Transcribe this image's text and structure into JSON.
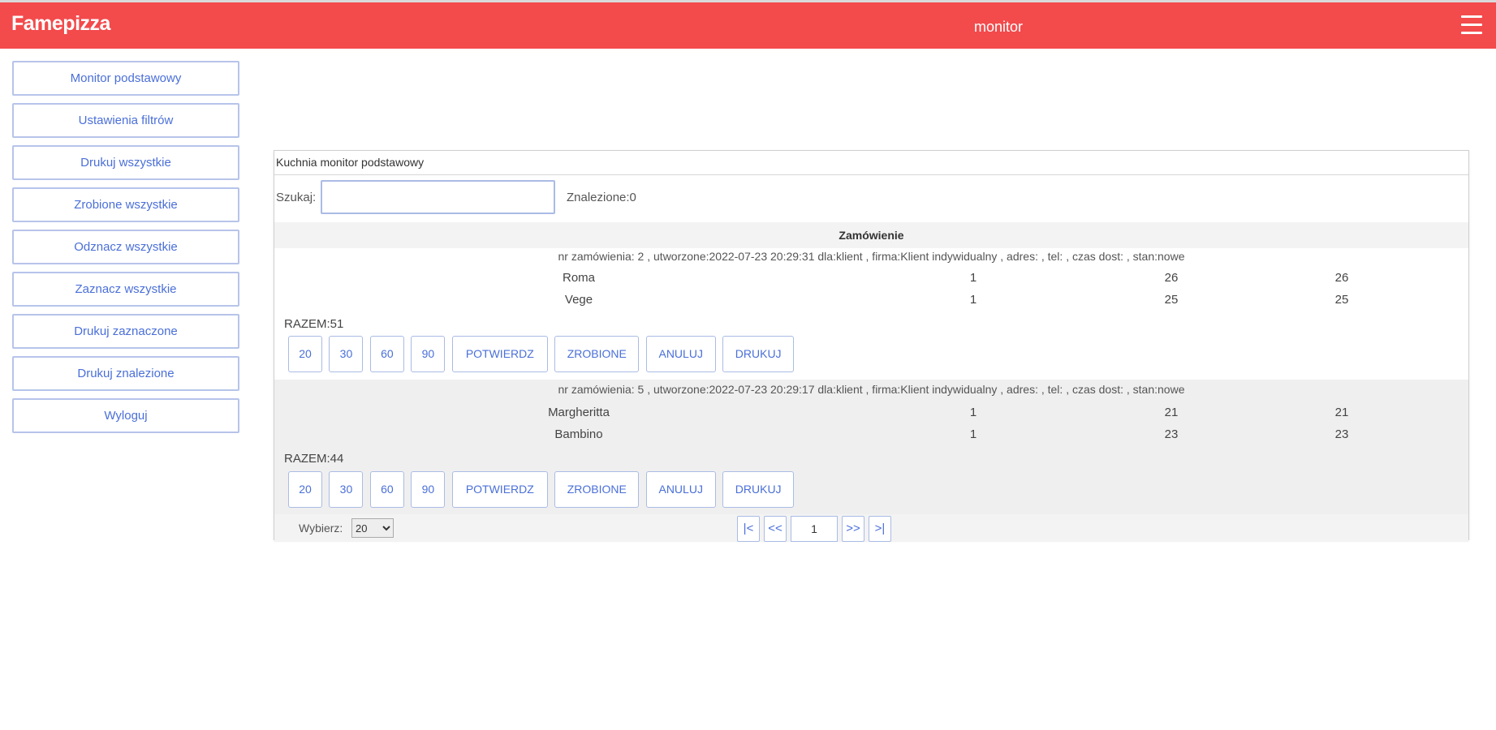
{
  "header": {
    "brand": "Famepizza",
    "title": "monitor",
    "menu_icon": "hamburger-menu-icon",
    "background_color": "#f34a4c"
  },
  "sidebar": {
    "items": [
      {
        "label": "Monitor podstawowy"
      },
      {
        "label": "Ustawienia filtrów"
      },
      {
        "label": "Drukuj wszystkie"
      },
      {
        "label": "Zrobione wszystkie"
      },
      {
        "label": "Odznacz wszystkie"
      },
      {
        "label": "Zaznacz wszystkie"
      },
      {
        "label": "Drukuj zaznaczone"
      },
      {
        "label": "Drukuj znalezione"
      },
      {
        "label": "Wyloguj"
      }
    ]
  },
  "panel": {
    "title": "Kuchnia monitor podstawowy",
    "search_label": "Szukaj:",
    "search_value": "",
    "found_label": "Znalezione:0",
    "column_header": "Zamówienie"
  },
  "orders": [
    {
      "info": "nr zamówienia: 2 , utworzone:2022-07-23 20:29:31 dla:klient , firma:Klient indywidualny , adres: , tel: , czas dost: , stan:nowe",
      "items": [
        {
          "name": "Roma",
          "qty": "1",
          "price": "26",
          "total": "26"
        },
        {
          "name": "Vege",
          "qty": "1",
          "price": "25",
          "total": "25"
        }
      ],
      "sum": "RAZEM:51",
      "buttons": [
        "20",
        "30",
        "60",
        "90",
        "POTWIERDZ",
        "ZROBIONE",
        "ANULUJ",
        "DRUKUJ"
      ]
    },
    {
      "info": "nr zamówienia: 5 , utworzone:2022-07-23 20:29:17 dla:klient , firma:Klient indywidualny , adres: , tel: , czas dost: , stan:nowe",
      "items": [
        {
          "name": "Margheritta",
          "qty": "1",
          "price": "21",
          "total": "21"
        },
        {
          "name": "Bambino",
          "qty": "1",
          "price": "23",
          "total": "23"
        }
      ],
      "sum": "RAZEM:44",
      "buttons": [
        "20",
        "30",
        "60",
        "90",
        "POTWIERDZ",
        "ZROBIONE",
        "ANULUJ",
        "DRUKUJ"
      ]
    }
  ],
  "pager": {
    "label": "Wybierz:",
    "per_page": "20",
    "first": "|<",
    "prev": "<<",
    "page": "1",
    "next": ">>",
    "last": ">|"
  }
}
